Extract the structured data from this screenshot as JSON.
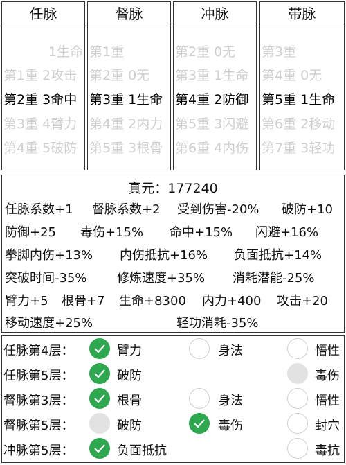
{
  "columns": [
    {
      "title": "任脉",
      "rows": [
        "1生命",
        "第1重 2攻击",
        "第2重 3命中",
        "第3重 4臂力",
        "第4重 5破防"
      ]
    },
    {
      "title": "督脉",
      "rows": [
        "第1重",
        "第2重 0无",
        "第3重 1生命",
        "第4重 2内力",
        "第5重 3根骨"
      ]
    },
    {
      "title": "冲脉",
      "rows": [
        "第2重 0无",
        "第3重 1生命",
        "第4重 2防御",
        "第5重 3闪避",
        "第6重 4内伤"
      ]
    },
    {
      "title": "带脉",
      "rows": [
        "第3重",
        "第4重 0无",
        "第5重 1生命",
        "第6重 2移动",
        "第7重 3轻功"
      ]
    }
  ],
  "stats": {
    "zhenyuan": "真元：177240",
    "lines": [
      [
        "任脉系数+1",
        "督脉系数+2",
        "受到伤害-20%",
        "破防+10"
      ],
      [
        "防御+25",
        "毒伤+15%",
        "命中+15%",
        "闪避+16%"
      ],
      [
        "拳脚内伤+13%",
        "内伤抵抗+16%",
        "负面抵抗+14%"
      ],
      [
        "突破时间-35%",
        "修炼速度+35%",
        "消耗潜能-25%"
      ],
      [
        "臂力+5",
        "根骨+7",
        "生命+8300",
        "内力+400",
        "攻击+20"
      ],
      [
        "移动速度+25%",
        "轻功消耗-35%"
      ]
    ]
  },
  "choices": [
    {
      "label": "任脉第4层：",
      "options": [
        {
          "text": "臂力",
          "state": "checked"
        },
        {
          "text": "身法",
          "state": "unchecked"
        },
        {
          "text": "悟性",
          "state": "unchecked"
        }
      ]
    },
    {
      "label": "任脉第5层：",
      "options": [
        {
          "text": "破防",
          "state": "checked"
        },
        {
          "text": "毒伤",
          "state": "disabled"
        }
      ]
    },
    {
      "label": "督脉第3层：",
      "options": [
        {
          "text": "根骨",
          "state": "checked"
        },
        {
          "text": "身法",
          "state": "unchecked"
        },
        {
          "text": "悟性",
          "state": "unchecked"
        }
      ]
    },
    {
      "label": "督脉第5层：",
      "options": [
        {
          "text": "破防",
          "state": "disabled"
        },
        {
          "text": "毒伤",
          "state": "checked"
        },
        {
          "text": "封穴",
          "state": "unchecked"
        }
      ]
    },
    {
      "label": "冲脉第5层：",
      "options": [
        {
          "text": "负面抵抗",
          "state": "checked"
        },
        {
          "text": "毒抗",
          "state": "unchecked"
        }
      ]
    }
  ],
  "colors": {
    "checked": "#2ea84f",
    "disabled": "#e2e2e2",
    "ghost_text": "#cfcfcf"
  }
}
